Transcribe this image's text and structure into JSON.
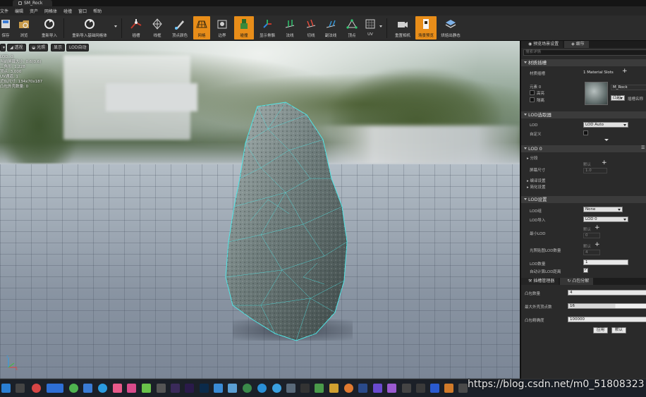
{
  "titlebar": {
    "tab_title": "SM_Rock"
  },
  "menubar": {
    "items": [
      "文件",
      "编辑",
      "资产",
      "网格体",
      "碰撞",
      "窗口",
      "帮助"
    ]
  },
  "toolbar": {
    "buttons": [
      {
        "label": "保存",
        "icon": "save-icon"
      },
      {
        "label": "浏览",
        "icon": "browse-icon"
      },
      {
        "label": "重新导入",
        "icon": "reimport-icon"
      },
      {
        "label": "重新导入基础网格体",
        "icon": "reimport-base-mesh-icon"
      },
      {
        "label": "插槽",
        "icon": "socket-icon"
      },
      {
        "label": "线框",
        "icon": "wireframe-icon"
      },
      {
        "label": "顶点颜色",
        "icon": "vertex-color-icon"
      },
      {
        "label": "网格",
        "icon": "grid-icon"
      },
      {
        "label": "边界",
        "icon": "bounds-icon"
      },
      {
        "label": "碰撞",
        "icon": "collision-icon"
      },
      {
        "label": "显示骨骼",
        "icon": "show-pivot-icon"
      },
      {
        "label": "法线",
        "icon": "normals-icon"
      },
      {
        "label": "切线",
        "icon": "tangents-icon"
      },
      {
        "label": "副法线",
        "icon": "binormals-icon"
      },
      {
        "label": "顶点",
        "icon": "vertices-icon"
      },
      {
        "label": "UV",
        "icon": "uv-icon"
      },
      {
        "label": "重置相机",
        "icon": "reset-camera-icon"
      },
      {
        "label": "场景预览",
        "icon": "preview-scene-icon"
      },
      {
        "label": "烘焙出静态",
        "icon": "bake-out-icon"
      }
    ],
    "active": [
      "网格",
      "碰撞",
      "场景预览"
    ]
  },
  "viewport": {
    "buttons": [
      "透视",
      "光照",
      "显示",
      "LOD自动"
    ],
    "stats": [
      "LOD: 0",
      "当前屏幕大小: 0.6(0.6)",
      "三角形: 1,228",
      "顶点: 3,000",
      "UV通道: 1",
      "近似尺寸: 134x70x187",
      "凸包外壳数量: 0"
    ]
  },
  "details": {
    "tabs": [
      "预览场景设置",
      "细节"
    ],
    "search_placeholder": "搜索详情",
    "material_section": "材质插槽",
    "material_slots_label": "材质插槽",
    "material_slots_value": "1 Material Slots",
    "element_label": "元素 0",
    "highlight_label": "高亮",
    "isolate_label": "隔离",
    "material_name": "M_Rock",
    "material_dropdown": "凸起",
    "slot_name_label": "插槽名称",
    "lod_picker_section": "LOD选取器",
    "lod_label": "LOD",
    "lod_value": "LOD Auto",
    "custom_label": "自定义",
    "lod0_section": "LOD 0",
    "sections_label": "分段",
    "screen_size_label": "屏幕尺寸",
    "screen_size_default": "默认",
    "screen_size_value": "1.0",
    "build_settings_label": "编译设置",
    "reduction_settings_label": "简化设置",
    "lod_settings_section": "LOD设置",
    "lod_group_label": "LOD组",
    "lod_group_value": "None",
    "lod_import_label": "LOD导入",
    "lod_import_value": "LOD 0",
    "min_lod_label": "最小LOD",
    "min_lod_default": "默认",
    "min_lod_value": "0",
    "lightmap_label": "光照贴图LOD数量",
    "lightmap_default": "默认",
    "lightmap_value": "4",
    "num_lods_label": "LOD数量",
    "num_lods_value": "1",
    "auto_compute_label": "自动计算LOD距离"
  },
  "bottom_panel": {
    "tabs": [
      "插槽管理器",
      "凸包分解"
    ],
    "hull_count_label": "凸包数量",
    "hull_count_value": "4",
    "max_verts_label": "最大外壳顶点数",
    "max_verts_value": "16",
    "accuracy_label": "凸包精确度",
    "accuracy_value": "100000",
    "apply_button": "应用",
    "default_button": "默认"
  },
  "watermark": "https://blog.csdn.net/m0_51808323",
  "colors": {
    "accent": "#e88d19",
    "panel_bg": "#2a2a2a",
    "wire": "#4fe6e6"
  }
}
